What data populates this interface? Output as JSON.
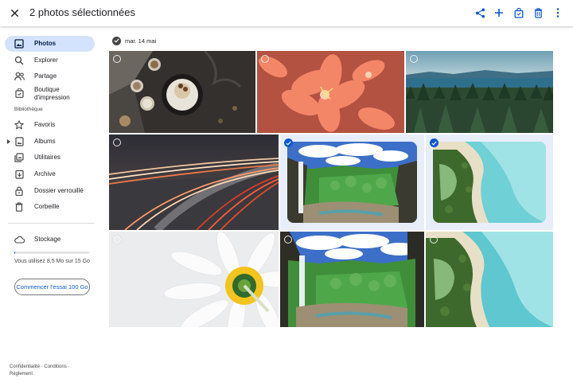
{
  "header": {
    "title": "2 photos sélectionnées",
    "actions": [
      "share-icon",
      "add-icon",
      "shopping-bag-icon",
      "trash-icon",
      "more-vert-icon"
    ]
  },
  "sidebar": {
    "items": [
      {
        "label": "Photos",
        "icon": "photos-icon",
        "active": true
      },
      {
        "label": "Explorer",
        "icon": "search-icon"
      },
      {
        "label": "Partage",
        "icon": "people-icon"
      },
      {
        "label": "Boutique d'impression",
        "icon": "print-store-icon"
      }
    ],
    "library_title": "Bibliothèque",
    "library_items": [
      {
        "label": "Favoris",
        "icon": "star-icon"
      },
      {
        "label": "Albums",
        "icon": "album-icon"
      },
      {
        "label": "Utilitaires",
        "icon": "utilities-icon"
      },
      {
        "label": "Archive",
        "icon": "archive-icon"
      },
      {
        "label": "Dossier verrouillé",
        "icon": "lock-icon"
      },
      {
        "label": "Corbeille",
        "icon": "trash-icon"
      }
    ],
    "storage": {
      "label": "Stockage",
      "icon": "cloud-icon",
      "usage_text": "Vous utilisez 8,5 Mo sur 15 Go",
      "used_fraction": 0.01,
      "button": "Commencer l'essai 100 Go"
    },
    "footer": {
      "privacy": "Confidentialité",
      "separator": "·",
      "terms": "Conditions",
      "policy": "Règlement"
    }
  },
  "main": {
    "date_label": "mar. 14 mai",
    "photos": [
      {
        "subject": "food-flatlay",
        "selected": false
      },
      {
        "subject": "orange-flowers",
        "selected": false
      },
      {
        "subject": "forest-lake",
        "selected": false
      },
      {
        "subject": "highway-light-trails",
        "selected": false
      },
      {
        "subject": "waterfall-canyon",
        "selected": true
      },
      {
        "subject": "aerial-coast",
        "selected": true
      },
      {
        "subject": "white-daisy",
        "selected": false
      },
      {
        "subject": "waterfall-canyon",
        "selected": false
      },
      {
        "subject": "aerial-coast",
        "selected": false
      }
    ]
  },
  "colors": {
    "accent": "#0b57d0",
    "active_nav_bg": "#d3e3fd",
    "selected_tile_bg": "#e8eef9"
  }
}
